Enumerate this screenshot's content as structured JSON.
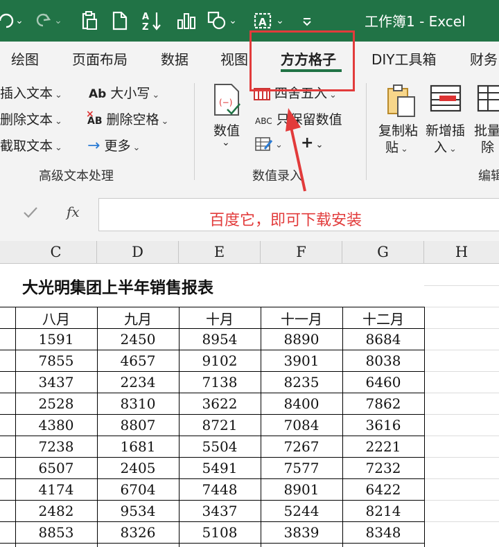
{
  "titlebar": {
    "title": "工作簿1  -  Excel",
    "icons": [
      "undo-icon",
      "redo-icon",
      "clipboard-icon",
      "new-file-icon",
      "sort-az-icon",
      "chart-icon",
      "shapes-icon",
      "textbox-icon",
      "customize-toolbar-icon"
    ]
  },
  "tabs": [
    {
      "label": "绘图"
    },
    {
      "label": "页面布局"
    },
    {
      "label": "数据"
    },
    {
      "label": "视图"
    },
    {
      "label": "方方格子",
      "active": true
    },
    {
      "label": "DIY工具箱"
    },
    {
      "label": "财务"
    }
  ],
  "ribbon": {
    "text_group": {
      "insert_text": "插入文本",
      "delete_text": "删除文本",
      "extract_text": "截取文本",
      "case": "大小写",
      "case_prefix": "Ab",
      "delete_spaces": "删除空格",
      "delete_spaces_prefix": "AB",
      "more": "更多",
      "label": "高级文本处理"
    },
    "number_group": {
      "values": "数值",
      "round": "四舍五入",
      "keep_values": "只保留数值",
      "keep_values_prefix": "ABC",
      "plus": "+",
      "label": "数值录入"
    },
    "edit_group": {
      "copy_paste_line1": "复制粘",
      "copy_paste_line2": "贴",
      "new_insert_line1": "新增插",
      "new_insert_line2": "入",
      "batch_delete_line1": "批量",
      "batch_delete_line2": "除",
      "label": "编辑"
    }
  },
  "formula_bar": {
    "fx": "fx",
    "annotation": "百度它，即可下载安装"
  },
  "sheet": {
    "columns": [
      "C",
      "D",
      "E",
      "F",
      "G",
      "H"
    ],
    "title": "大光明集团上半年销售报表",
    "headers": [
      "八月",
      "九月",
      "十月",
      "十一月",
      "十二月"
    ],
    "rows": [
      [
        1591,
        2450,
        8954,
        8890,
        8684
      ],
      [
        7855,
        4657,
        9102,
        3901,
        8038
      ],
      [
        3437,
        2234,
        7138,
        8235,
        6460
      ],
      [
        2528,
        8310,
        3622,
        8400,
        7862
      ],
      [
        4380,
        8807,
        8721,
        7084,
        3616
      ],
      [
        7238,
        1681,
        5504,
        7267,
        2221
      ],
      [
        6507,
        2405,
        5491,
        7577,
        7232
      ],
      [
        4174,
        6704,
        7448,
        8901,
        6422
      ],
      [
        2482,
        9534,
        3437,
        5244,
        8214
      ],
      [
        8853,
        8326,
        5108,
        3839,
        8348
      ]
    ]
  },
  "colors": {
    "excel_green": "#217346",
    "annotation_red": "#e23b3b",
    "ribbon_bg": "#f3f3f3"
  }
}
